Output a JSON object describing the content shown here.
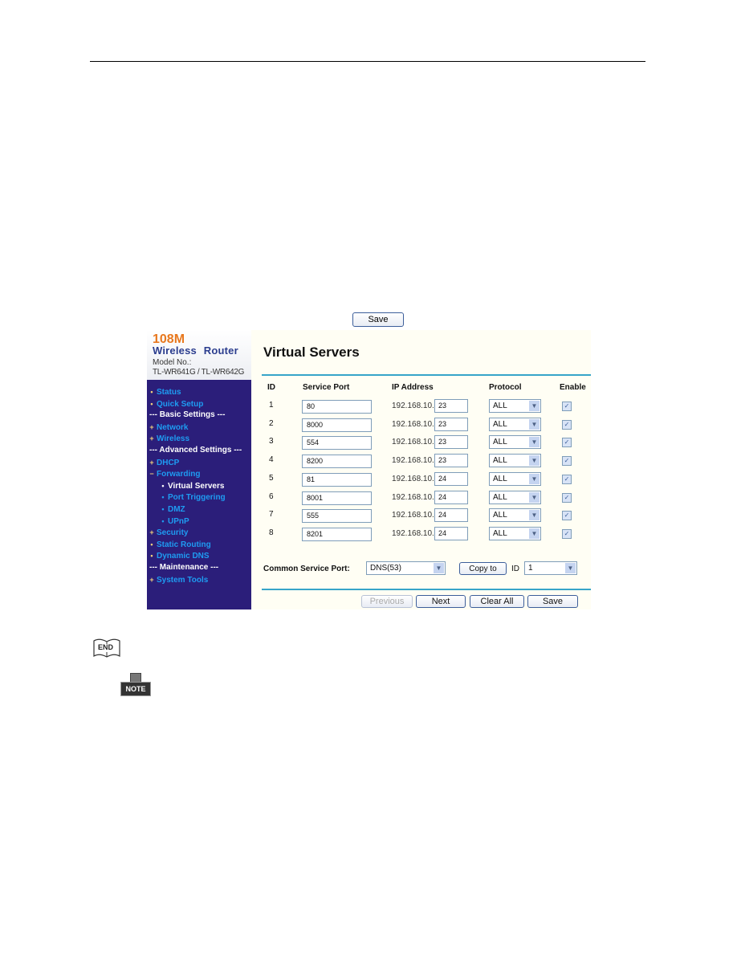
{
  "top_save_label": "Save",
  "brand": {
    "speed": "108M",
    "product": "Wireless Router",
    "model_label": "Model No.:",
    "models": "TL-WR641G / TL-WR642G"
  },
  "menu": [
    {
      "label": "Status",
      "type": "item",
      "bullet": "•"
    },
    {
      "label": "Quick Setup",
      "type": "item",
      "bullet": "•"
    },
    {
      "label": "--- Basic Settings ---",
      "type": "section"
    },
    {
      "label": "Network",
      "type": "item",
      "bullet": "+"
    },
    {
      "label": "Wireless",
      "type": "item",
      "bullet": "+"
    },
    {
      "label": "--- Advanced Settings ---",
      "type": "section"
    },
    {
      "label": "DHCP",
      "type": "item",
      "bullet": "+"
    },
    {
      "label": "Forwarding",
      "type": "item",
      "bullet": "−"
    },
    {
      "label": "Virtual Servers",
      "type": "sub",
      "bullet": "•",
      "active": true
    },
    {
      "label": "Port Triggering",
      "type": "sub",
      "bullet": "•"
    },
    {
      "label": "DMZ",
      "type": "sub",
      "bullet": "•"
    },
    {
      "label": "UPnP",
      "type": "sub",
      "bullet": "•"
    },
    {
      "label": "Security",
      "type": "item",
      "bullet": "+"
    },
    {
      "label": "Static Routing",
      "type": "item",
      "bullet": "•"
    },
    {
      "label": "Dynamic DNS",
      "type": "item",
      "bullet": "•"
    },
    {
      "label": "--- Maintenance ---",
      "type": "section"
    },
    {
      "label": "System Tools",
      "type": "item",
      "bullet": "+"
    }
  ],
  "page_title": "Virtual Servers",
  "columns": {
    "id": "ID",
    "service_port": "Service Port",
    "ip_address": "IP Address",
    "protocol": "Protocol",
    "enable": "Enable"
  },
  "ip_prefix": "192.168.10.",
  "rows": [
    {
      "id": "1",
      "service_port": "80",
      "ip": "23",
      "protocol": "ALL",
      "enabled": true
    },
    {
      "id": "2",
      "service_port": "8000",
      "ip": "23",
      "protocol": "ALL",
      "enabled": true
    },
    {
      "id": "3",
      "service_port": "554",
      "ip": "23",
      "protocol": "ALL",
      "enabled": true
    },
    {
      "id": "4",
      "service_port": "8200",
      "ip": "23",
      "protocol": "ALL",
      "enabled": true
    },
    {
      "id": "5",
      "service_port": "81",
      "ip": "24",
      "protocol": "ALL",
      "enabled": true
    },
    {
      "id": "6",
      "service_port": "8001",
      "ip": "24",
      "protocol": "ALL",
      "enabled": true
    },
    {
      "id": "7",
      "service_port": "555",
      "ip": "24",
      "protocol": "ALL",
      "enabled": true
    },
    {
      "id": "8",
      "service_port": "8201",
      "ip": "24",
      "protocol": "ALL",
      "enabled": true
    }
  ],
  "common_service": {
    "label": "Common Service Port:",
    "selected": "DNS(53)",
    "copy_label": "Copy to",
    "id_label": "ID",
    "id_selected": "1"
  },
  "buttons": {
    "previous": "Previous",
    "next": "Next",
    "clear_all": "Clear All",
    "save": "Save"
  },
  "icons": {
    "end_label": "END",
    "note_label": "NOTE"
  },
  "colors": {
    "sidebar_bg": "#2b1e7a",
    "menu_link": "#1e9cf2",
    "brand_orange": "#e8781e",
    "brand_blue": "#2b3d8e",
    "divider": "#37a5c9",
    "main_bg": "#fffef4"
  }
}
